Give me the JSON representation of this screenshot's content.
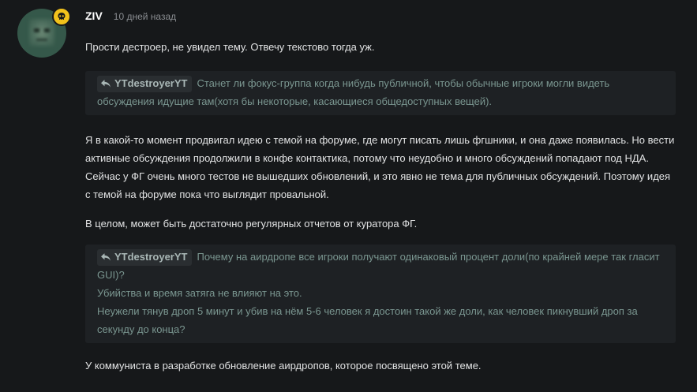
{
  "post": {
    "author": "ZIV",
    "time": "10 дней назад",
    "paragraph_1": "Прости дестроер, не увидел тему. Отвечу текстово тогда уж.",
    "quote_1": {
      "author": "YTdestroyerYT",
      "text": "Станет ли фокус-группа когда нибудь публичной, чтобы обычные игроки могли видеть обсуждения идущие там(хотя бы некоторые, касающиеся общедоступных вещей)."
    },
    "paragraph_2": "Я в какой-то момент продвигал идею с темой на форуме, где могут писать лишь фгшники, и она даже появилась. Но вести активные обсуждения продолжили в конфе контактика, потому что неудобно и много обсуждений попадают под НДА. Сейчас у ФГ очень много тестов не вышедших обновлений, и это явно не тема для публичных обсуждений. Поэтому идея с темой на форуме пока что выглядит провальной.",
    "paragraph_3": "В целом, может быть достаточно регулярных отчетов от куратора ФГ.",
    "quote_2": {
      "author": "YTdestroyerYT",
      "line_1": "Почему на аирдропе все игроки получают одинаковый процент доли(по крайней мере так гласит GUI)?",
      "line_2": "Убийства и время затяга не влияют на это.",
      "line_3": "Неужели тянув дроп 5 минут и убив на нём 5-6 человек я достоин такой же доли, как человек пикнувший дроп за секунду до конца?"
    },
    "paragraph_4": "У коммуниста в разработке обновление аирдропов, которое посвящено этой теме."
  },
  "icons": {
    "badge": "skull-icon",
    "quote_reply": "reply-arrow-icon"
  },
  "colors": {
    "background": "#16181a",
    "badge": "#f2c21b",
    "quote_background": "#1e2124",
    "quote_text": "#7a9690"
  }
}
